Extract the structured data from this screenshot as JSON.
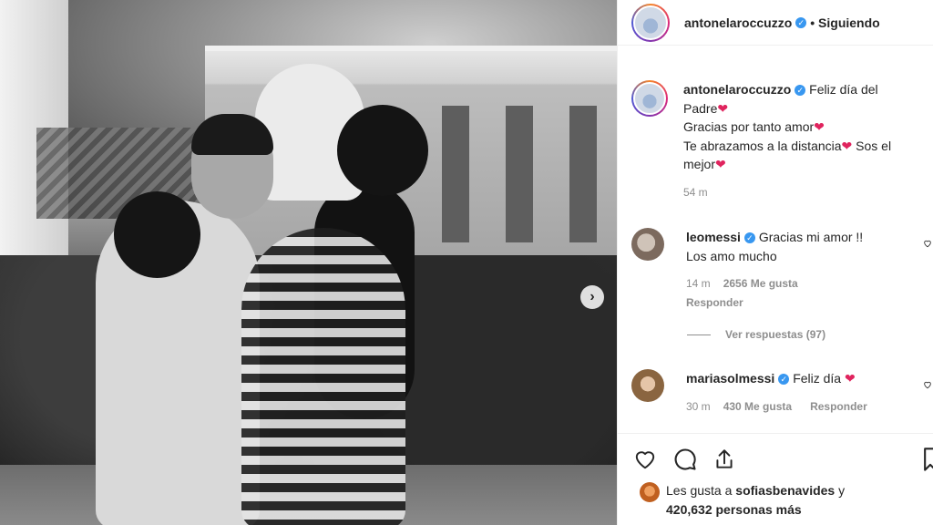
{
  "post": {
    "author": "antonelaroccuzzo",
    "follow_status": "• Siguiendo",
    "verified_mark": "✓"
  },
  "caption": {
    "username": "antonelaroccuzzo",
    "line1": "Feliz día del",
    "line2": "Padre",
    "line3": "Gracias por tanto amor",
    "line4": "Te abrazamos a la distancia",
    "line4b": "Sos el",
    "line5": "mejor",
    "time": "54 m",
    "heart": "❤"
  },
  "comments": [
    {
      "username": "leomessi",
      "text_line1": "Gracias mi amor !!",
      "text_line2": "Los amo mucho",
      "time": "14 m",
      "likes": "2656 Me gusta",
      "reply": "Responder"
    },
    {
      "username": "mariasolmessi",
      "text_line1": "Feliz día",
      "time": "30 m",
      "likes": "430 Me gusta",
      "reply": "Responder"
    }
  ],
  "view_replies": "Ver respuestas (97)",
  "likes_summary": {
    "prefix": "Les gusta a",
    "user": "sofiasbenavides",
    "suffix": "y",
    "count": "420,632 personas más"
  },
  "icons": {
    "nav_next": "chevron-right-icon",
    "like": "heart-icon",
    "comment": "comment-icon",
    "share": "share-icon",
    "save": "bookmark-icon"
  },
  "colors": {
    "verified": "#3897f0",
    "heart": "#e0245e",
    "muted_text": "#8e8e8e",
    "primary_text": "#262626"
  }
}
